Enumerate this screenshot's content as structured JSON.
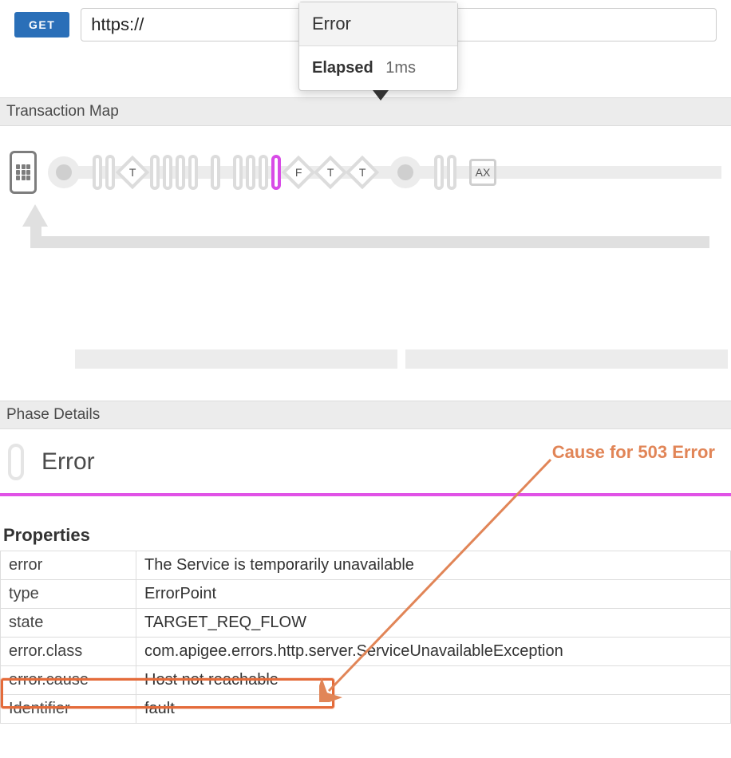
{
  "request": {
    "method": "GET",
    "url": "https://"
  },
  "tooltip": {
    "title": "Error",
    "elapsed_label": "Elapsed",
    "elapsed_value": "1ms"
  },
  "transaction_map": {
    "heading": "Transaction Map",
    "nodes": {
      "diamond_t": "T",
      "diamond_f": "F",
      "box_ax": "AX"
    }
  },
  "phase_details": {
    "heading": "Phase Details",
    "title": "Error",
    "annotation": "Cause for 503 Error",
    "properties_label": "Properties",
    "rows": [
      {
        "key": "error",
        "value": "The Service is temporarily unavailable"
      },
      {
        "key": "type",
        "value": "ErrorPoint"
      },
      {
        "key": "state",
        "value": "TARGET_REQ_FLOW"
      },
      {
        "key": "error.class",
        "value": "com.apigee.errors.http.server.ServiceUnavailableException"
      },
      {
        "key": "error.cause",
        "value": "Host not reachable"
      },
      {
        "key": "Identifier",
        "value": "fault"
      }
    ]
  }
}
